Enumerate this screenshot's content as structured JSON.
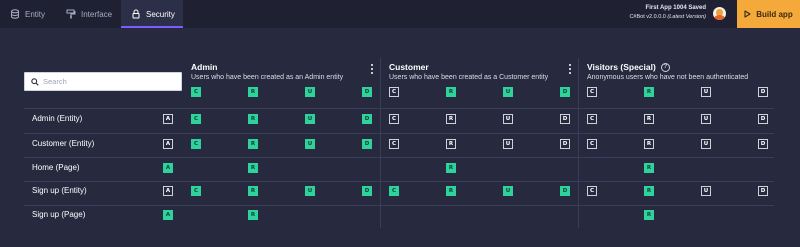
{
  "tabs": [
    {
      "label": "Entity",
      "icon": "database-icon"
    },
    {
      "label": "Interface",
      "icon": "paint-roller-icon"
    },
    {
      "label": "Security",
      "icon": "lock-icon"
    }
  ],
  "app": {
    "name": "First App 1004 Saved",
    "version": "C#Bot v2.0.0.0",
    "version_tag": "(Latest Version)",
    "build_label": "Build app"
  },
  "search": {
    "placeholder": "Search",
    "value": ""
  },
  "roles": [
    {
      "title": "Admin",
      "desc": "Users who have been created as an Admin entity"
    },
    {
      "title": "Customer",
      "desc": "Users who have been created as a Customer entity"
    },
    {
      "title": "Visitors (Special)",
      "desc": "Anonymous users who have not been authenticated"
    }
  ],
  "header_perms": [
    "C",
    "R",
    "U",
    "D"
  ],
  "all_letter": "A",
  "rows": [
    {
      "label": "Admin (Entity)",
      "all": true,
      "admin": [
        "C",
        "R",
        "U",
        "D"
      ],
      "customer": [
        "C",
        "R",
        "U",
        "D"
      ],
      "visitor": [
        "C",
        "R",
        "U",
        "D"
      ],
      "customer_on": [
        false,
        false,
        false,
        false
      ],
      "visitor_on": [
        false,
        false,
        false,
        false
      ]
    },
    {
      "label": "Customer (Entity)",
      "all": true,
      "admin": [
        "C",
        "R",
        "U",
        "D"
      ],
      "customer": [
        "C",
        "R",
        "U",
        "D"
      ],
      "visitor": [
        "C",
        "R",
        "U",
        "D"
      ],
      "customer_on": [
        false,
        false,
        false,
        false
      ],
      "visitor_on": [
        false,
        false,
        false,
        false
      ]
    },
    {
      "label": "Home (Page)",
      "all": false,
      "admin": [
        "R"
      ],
      "customer": [
        "R"
      ],
      "visitor": [
        "R"
      ]
    },
    {
      "label": "Sign up (Entity)",
      "all": true,
      "admin": [
        "C",
        "R",
        "U",
        "D"
      ],
      "customer": [
        "C",
        "R",
        "U",
        "D"
      ],
      "visitor": [
        "C",
        "R",
        "U",
        "D"
      ],
      "customer_on": [
        true,
        true,
        true,
        true
      ],
      "visitor_on": [
        false,
        true,
        false,
        false
      ]
    },
    {
      "label": "Sign up (Page)",
      "all": false,
      "admin": [
        "R"
      ],
      "customer": [],
      "visitor": [
        "R"
      ]
    }
  ],
  "colors": {
    "accent": "#7c5cff",
    "build": "#f4a93a",
    "perm_on": "#2ed29a",
    "background": "#272a3f"
  }
}
